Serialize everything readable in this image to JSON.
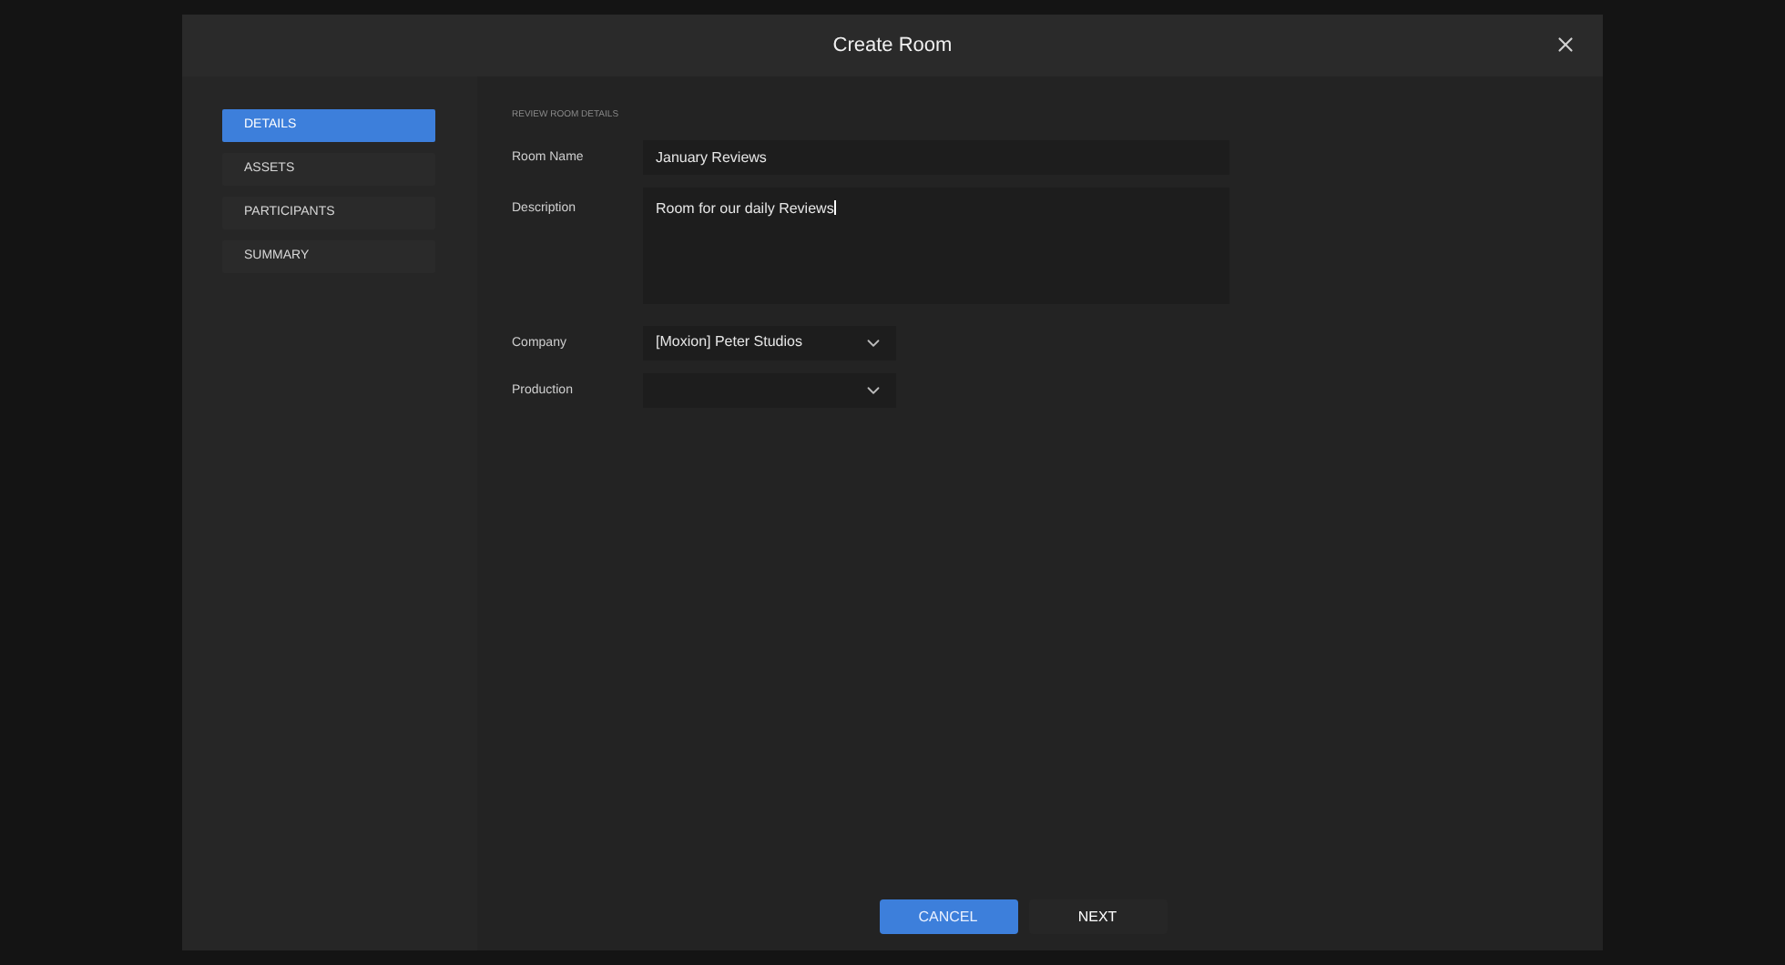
{
  "window": {
    "title": "Create Room"
  },
  "sidebar": {
    "items": [
      {
        "label": "DETAILS",
        "selected": true
      },
      {
        "label": "ASSETS",
        "selected": false
      },
      {
        "label": "PARTICIPANTS",
        "selected": false
      },
      {
        "label": "SUMMARY",
        "selected": false
      }
    ]
  },
  "form": {
    "section_title": "REVIEW ROOM DETAILS",
    "fields": [
      {
        "kind": "text",
        "label": "Room Name",
        "value": "January Reviews"
      },
      {
        "kind": "textarea",
        "label": "Description",
        "value": "Room for our daily Reviews"
      },
      {
        "kind": "select",
        "label": "Company",
        "value": "[Moxion] Peter Studios"
      },
      {
        "kind": "select",
        "label": "Production"
      }
    ]
  },
  "buttons": [
    {
      "label": "CANCEL",
      "kind": "primary"
    },
    {
      "label": "NEXT",
      "kind": "secondary"
    }
  ]
}
